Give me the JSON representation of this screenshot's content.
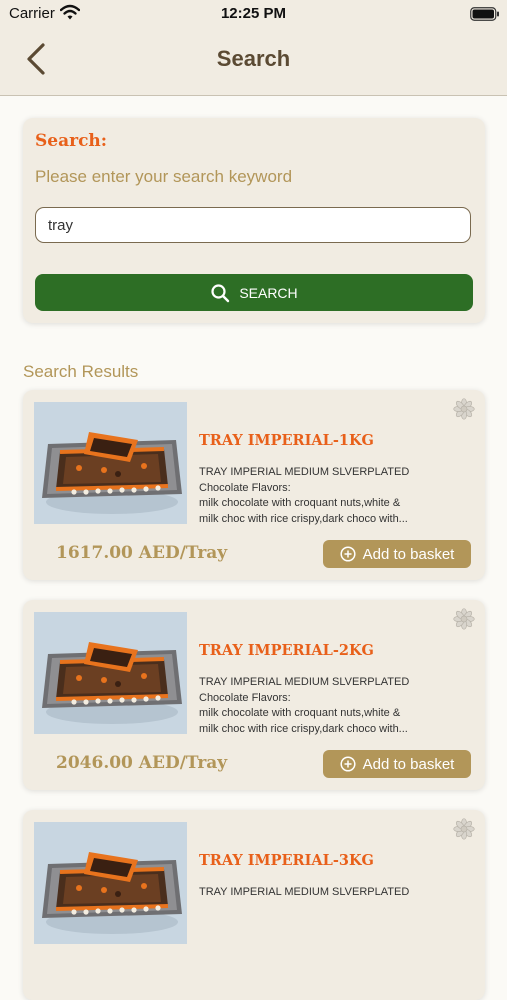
{
  "status_bar": {
    "carrier": "Carrier",
    "time": "12:25 PM"
  },
  "nav": {
    "title": "Search"
  },
  "search": {
    "heading": "Search:",
    "hint": "Please enter your search keyword",
    "value": "tray",
    "button_label": "SEARCH"
  },
  "results": {
    "title": "Search Results",
    "items": [
      {
        "name": "TRAY IMPERIAL-1KG",
        "desc_line1": "TRAY IMPERIAL MEDIUM SLVERPLATED",
        "desc_line2": "Chocolate Flavors:",
        "desc_line3": "milk chocolate with croquant nuts,white &",
        "desc_line4": "milk choc with rice crispy,dark choco with...",
        "price": "1617.00 AED/Tray",
        "button_label": "Add to basket"
      },
      {
        "name": "TRAY IMPERIAL-2KG",
        "desc_line1": "TRAY IMPERIAL MEDIUM SLVERPLATED",
        "desc_line2": "Chocolate Flavors:",
        "desc_line3": "milk chocolate with croquant nuts,white &",
        "desc_line4": "milk choc with rice crispy,dark choco with...",
        "price": "2046.00 AED/Tray",
        "button_label": "Add to basket"
      },
      {
        "name": "TRAY IMPERIAL-3KG",
        "desc_line1": "TRAY IMPERIAL MEDIUM SLVERPLATED",
        "desc_line2": "",
        "desc_line3": "",
        "desc_line4": "",
        "price": "",
        "button_label": ""
      }
    ]
  },
  "icons": {
    "back": "chevron-left-icon",
    "search": "search-icon",
    "add": "plus-circle-icon",
    "favorite": "flower-icon"
  },
  "colors": {
    "accent_orange": "#e8601a",
    "gold": "#b29659",
    "search_green": "#2d6e25",
    "card_bg": "#f1ece2",
    "title_brown": "#5b4a33"
  }
}
